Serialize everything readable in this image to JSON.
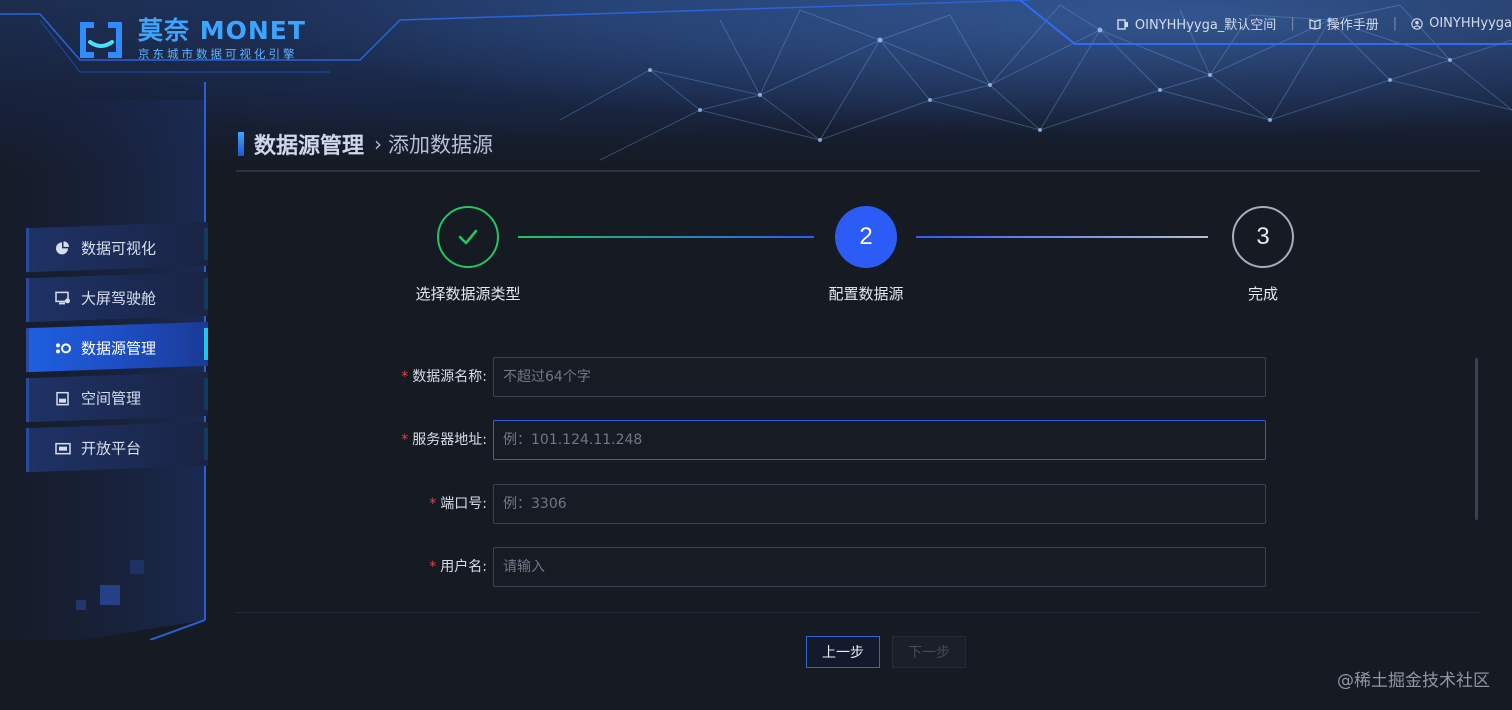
{
  "brand": {
    "title": "莫奈 MONET",
    "subtitle": "京东城市数据可视化引擎"
  },
  "header": {
    "workspace": "OINYHHyyga_默认空间",
    "manual": "操作手册",
    "user": "OINYHHyyga"
  },
  "sidebar": {
    "items": [
      {
        "label": "数据可视化",
        "icon": "pie-chart-icon",
        "active": false
      },
      {
        "label": "大屏驾驶舱",
        "icon": "monitor-icon",
        "active": false
      },
      {
        "label": "数据源管理",
        "icon": "datasource-icon",
        "active": true
      },
      {
        "label": "空间管理",
        "icon": "workspace-icon",
        "active": false
      },
      {
        "label": "开放平台",
        "icon": "platform-icon",
        "active": false
      }
    ]
  },
  "page": {
    "title": "数据源管理",
    "separator": "›",
    "subtitle": "添加数据源"
  },
  "steps": [
    {
      "number": "✓",
      "label": "选择数据源类型",
      "state": "done"
    },
    {
      "number": "2",
      "label": "配置数据源",
      "state": "current"
    },
    {
      "number": "3",
      "label": "完成",
      "state": "todo"
    }
  ],
  "form": {
    "required_mark": "*",
    "name": {
      "label": "数据源名称:",
      "placeholder": "不超过64个字",
      "value": ""
    },
    "host": {
      "label": "服务器地址:",
      "placeholder": "例：101.124.11.248",
      "value": ""
    },
    "port": {
      "label": "端口号:",
      "placeholder": "例：3306",
      "value": ""
    },
    "username": {
      "label": "用户名:",
      "placeholder": "请输入",
      "value": ""
    }
  },
  "buttons": {
    "prev": "上一步",
    "next": "下一步"
  },
  "watermark": "@稀土掘金技术社区",
  "colors": {
    "accent": "#2c5cf6",
    "success": "#22c55e",
    "required": "#e0474c",
    "background": "#161a23"
  }
}
